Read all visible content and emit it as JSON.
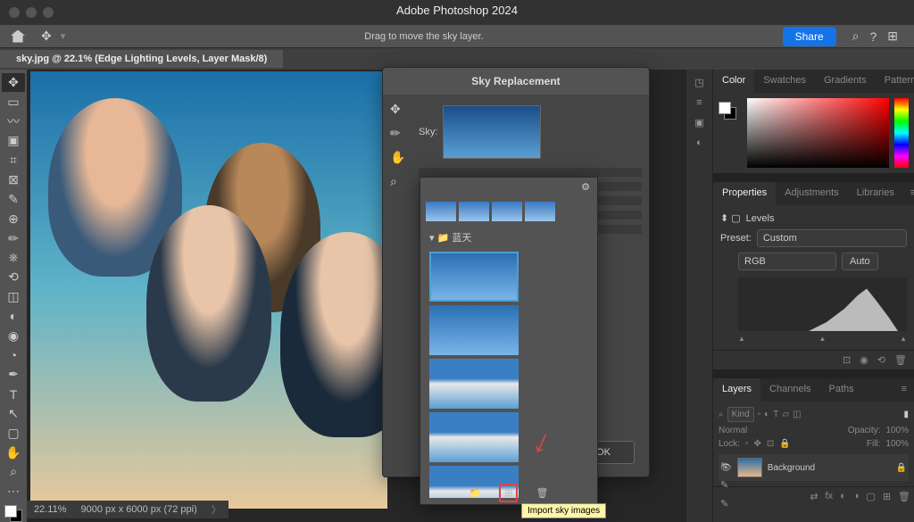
{
  "app_title": "Adobe Photoshop 2024",
  "top_bar": {
    "message": "Drag to move the sky layer.",
    "share": "Share"
  },
  "doc_tab": "sky.jpg @ 22.1% (Edge Lighting Levels, Layer Mask/8)",
  "sky_dialog": {
    "title": "Sky Replacement",
    "sky_label": "Sky:",
    "ok": "OK"
  },
  "sky_picker": {
    "folder": "蓝天",
    "tooltip": "Import sky images"
  },
  "panel_color": {
    "tabs": [
      "Color",
      "Swatches",
      "Gradients",
      "Patterns"
    ]
  },
  "panel_props": {
    "tabs": [
      "Properties",
      "Adjustments",
      "Libraries"
    ],
    "type": "Levels",
    "preset_label": "Preset:",
    "preset_value": "Custom",
    "channel": "RGB",
    "auto": "Auto"
  },
  "panel_layers": {
    "tabs": [
      "Layers",
      "Channels",
      "Paths"
    ],
    "kind": "Kind",
    "blend": "Normal",
    "opacity_label": "Opacity:",
    "opacity": "100%",
    "lock_label": "Lock:",
    "fill_label": "Fill:",
    "fill": "100%",
    "bg": "Background"
  },
  "status": {
    "zoom": "22.11%",
    "dims": "9000 px x 6000 px (72 ppi)"
  }
}
